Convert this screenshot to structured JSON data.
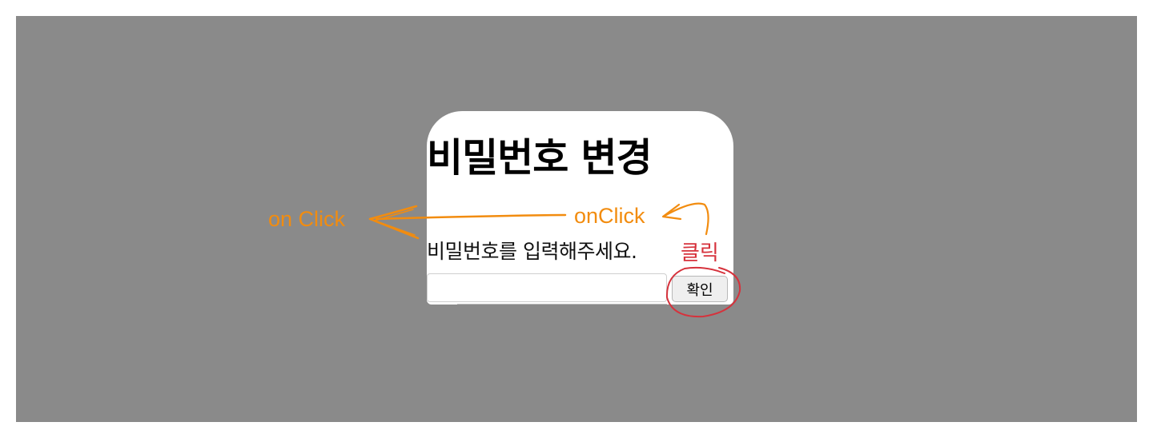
{
  "modal": {
    "title": "비밀번호 변경",
    "description": "비밀번호를 입력해주세요.",
    "input_value": "",
    "confirm_label": "확인"
  },
  "annotations": {
    "left_label": "on Click",
    "mid_label": "onClick",
    "click_label": "클릭"
  },
  "colors": {
    "overlay": "#8a8a8a",
    "annotation_orange": "#f28c0f",
    "annotation_red": "#d6323c"
  }
}
